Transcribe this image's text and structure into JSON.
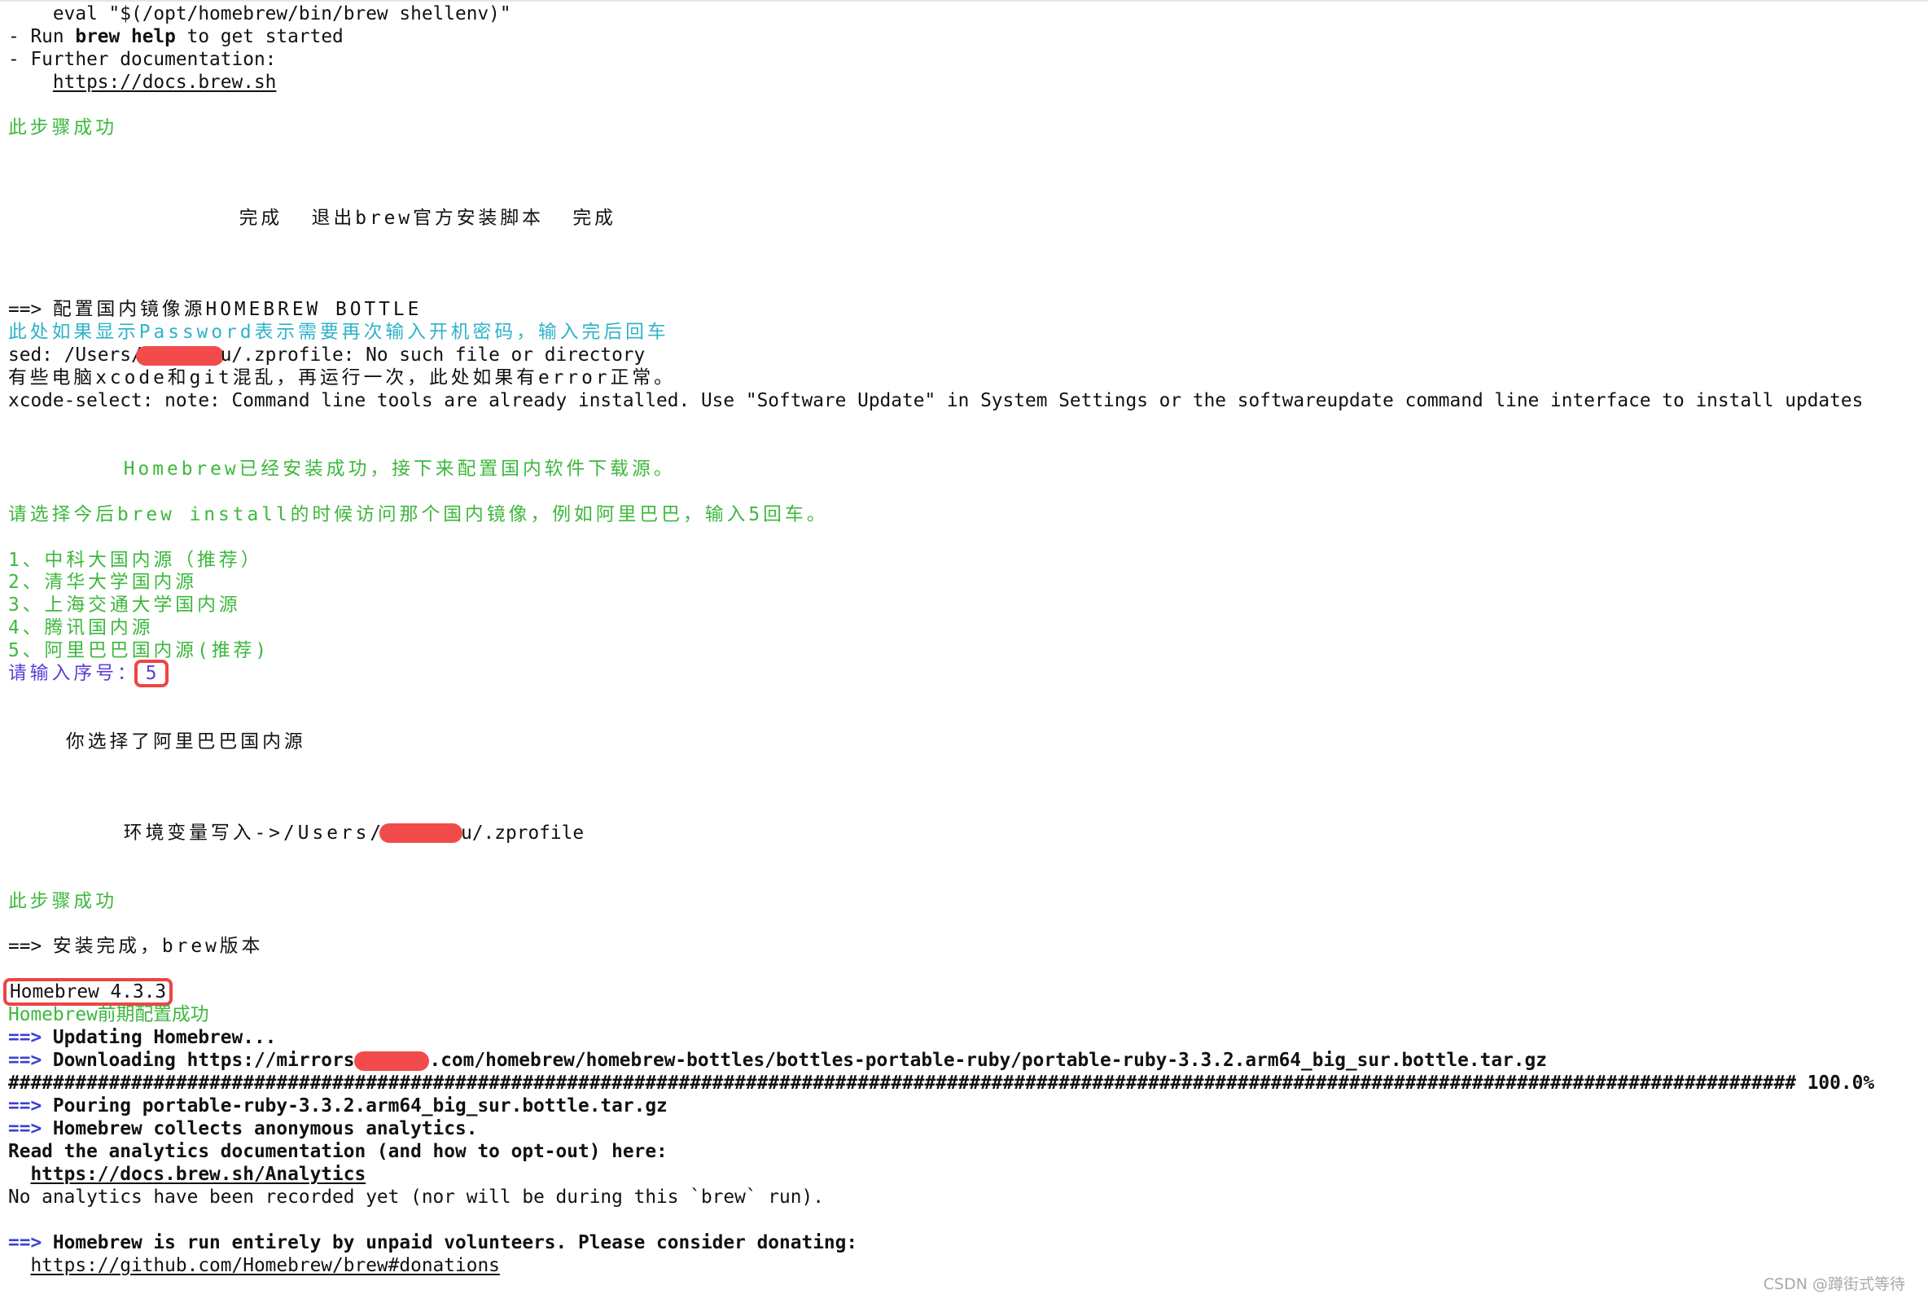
{
  "terminal": {
    "l0": "    eval \"$(/opt/homebrew/bin/brew shellenv)\"",
    "l1a": "- Run ",
    "l1b": "brew help",
    "l1c": " to get started",
    "l2": "- Further documentation:",
    "l3a": "    ",
    "l3b": "https://docs.brew.sh",
    "l5": "此步骤成功",
    "l9": "                完成  退出brew官方安装脚本  完成",
    "l13a": "==> ",
    "l13b": "配置国内镜像源HOMEBREW BOTTLE",
    "l14": "此处如果显示Password表示需要再次输入开机密码，输入完后回车",
    "l15a": "sed: /Users/",
    "l15b": "u/.zprofile: No such file or directory",
    "l16": "有些电脑xcode和git混乱，再运行一次，此处如果有error正常。",
    "l17": "xcode-select: note: Command line tools are already installed. Use \"Software Update\" in System Settings or the softwareupdate command line interface to install updates",
    "l20": "        Homebrew已经安装成功，接下来配置国内软件下载源。",
    "l22": "请选择今后brew install的时候访问那个国内镜像，例如阿里巴巴，输入5回车。",
    "mirrors": [
      "1、中科大国内源（推荐）",
      "2、清华大学国内源",
      "3、上海交通大学国内源",
      "4、腾讯国内源",
      "5、阿里巴巴国内源(推荐)"
    ],
    "prompt_label": "请输入序号：",
    "prompt_value": "5",
    "l32": "    你选择了阿里巴巴国内源",
    "l36a": "        环境变量写入->/Users/",
    "l36b": "u/.zprofile",
    "l39": "此步骤成功",
    "l41a": "==> ",
    "l41b": "安装完成，brew版本",
    "l43": "Homebrew 4.3.3",
    "l44": "Homebrew前期配置成功",
    "arrow": "==> ",
    "l45": "Updating Homebrew...",
    "l46a": "Downloading https://mirrors",
    "l46b": ".com/homebrew/homebrew-bottles/bottles-portable-ruby/portable-ruby-3.3.2.arm64_big_sur.bottle.tar.gz",
    "l47_bar": "################################################################################################################################################################",
    "l47_pct": " 100.0%",
    "l48": "Pouring portable-ruby-3.3.2.arm64_big_sur.bottle.tar.gz",
    "l49": "Homebrew collects anonymous analytics.",
    "l50": "Read the analytics documentation (and how to opt-out) here:",
    "l51a": "  ",
    "l51b": "https://docs.brew.sh/Analytics",
    "l52": "No analytics have been recorded yet (nor will be during this `brew` run).",
    "l54": "Homebrew is run entirely by unpaid volunteers. Please consider donating:",
    "l55a": "  ",
    "l55b": "https://github.com/Homebrew/brew#donations"
  },
  "download_progress_percent": 100.0,
  "colors": {
    "success_green": "#3cb83c",
    "hint_cyan": "#2fb3c9",
    "prompt_purple": "#5b3fd8",
    "arrow_blue": "#3b3fd6",
    "highlight_red": "#ef4444",
    "redaction_red": "#f24b4b"
  },
  "watermark": "CSDN @蹲街式等待"
}
